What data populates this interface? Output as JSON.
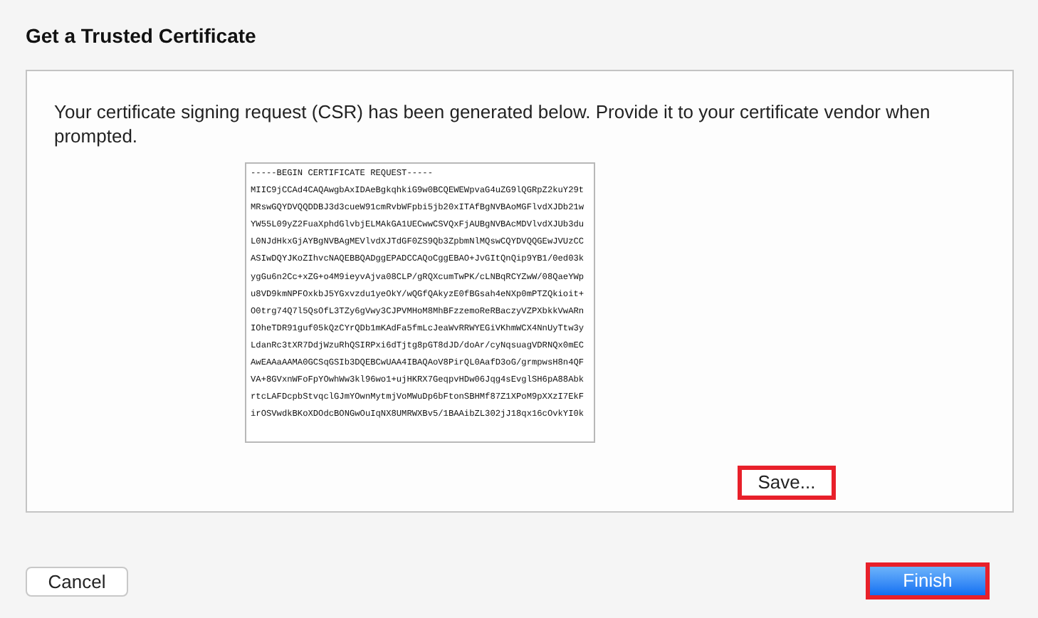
{
  "title": "Get a Trusted Certificate",
  "message": "Your certificate signing request (CSR) has been generated below. Provide it to your certificate vendor when prompted.",
  "csr_lines": [
    "-----BEGIN CERTIFICATE REQUEST-----",
    "MIIC9jCCAd4CAQAwgbAxIDAeBgkqhkiG9w0BCQEWEWpvaG4uZG9lQGRpZ2kuY29t",
    "MRswGQYDVQQDDBJ3d3cueW91cmRvbWFpbi5jb20xITAfBgNVBAoMGFlvdXJDb21w",
    "YW55L09yZ2FuaXphdGlvbjELMAkGA1UECwwCSVQxFjAUBgNVBAcMDVlvdXJUb3du",
    "L0NJdHkxGjAYBgNVBAgMEVlvdXJTdGF0ZS9Qb3ZpbmNlMQswCQYDVQQGEwJVUzCC",
    "ASIwDQYJKoZIhvcNAQEBBQADggEPADCCAQoCggEBAO+JvGItQnQip9YB1/0ed03k",
    "ygGu6n2Cc+xZG+o4M9ieyvAjva08CLP/gRQXcumTwPK/cLNBqRCYZwW/08QaeYWp",
    "u8VD9kmNPFOxkbJ5YGxvzdu1yeOkY/wQGfQAkyzE0fBGsah4eNXp0mPTZQkioit+",
    "O0trg74Q7l5QsOfL3TZy6gVwy3CJPVMHoM8MhBFzzemoReRBaczyVZPXbkkVwARn",
    "IOheTDR91guf05kQzCYrQDb1mKAdFa5fmLcJeaWvRRWYEGiVKhmWCX4NnUyTtw3y",
    "LdanRc3tXR7DdjWzuRhQSIRPxi6dTjtg8pGT8dJD/doAr/cyNqsuagVDRNQx0mEC",
    "AwEAAaAAMA0GCSqGSIb3DQEBCwUAA4IBAQAoV8PirQL0AafD3oG/grmpwsH8n4QF",
    "VA+8GVxnWFoFpYOwhWw3kl96wo1+ujHKRX7GeqpvHDw06Jqg4sEvglSH6pA88Abk",
    "rtcLAFDcpbStvqclGJmYOwnMytmjVoMWuDp6bFtonSBHMf87Z1XPoM9pXXzI7EkF",
    "irOSVwdkBKoXDOdcBONGwOuIqNX8UMRWXBv5/1BAAibZL302jJ18qx16cOvkYI0k"
  ],
  "save_button": {
    "label": "Save...",
    "highlighted": true
  },
  "cancel_button": {
    "label": "Cancel",
    "highlighted": false
  },
  "finish_button": {
    "label": "Finish",
    "highlighted": true
  }
}
